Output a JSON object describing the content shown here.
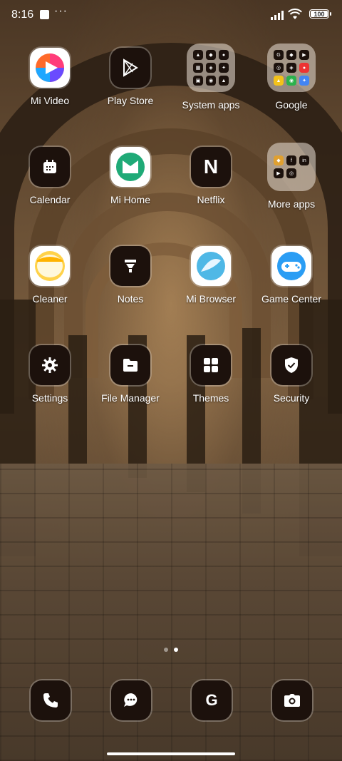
{
  "status_bar": {
    "time": "8:16",
    "battery": "100"
  },
  "apps": [
    {
      "key": "mi-video",
      "label": "Mi Video"
    },
    {
      "key": "play-store",
      "label": "Play Store"
    },
    {
      "key": "system-apps",
      "label": "System apps"
    },
    {
      "key": "google",
      "label": "Google"
    },
    {
      "key": "calendar",
      "label": "Calendar"
    },
    {
      "key": "mi-home",
      "label": "Mi Home"
    },
    {
      "key": "netflix",
      "label": "Netflix",
      "glyph": "N"
    },
    {
      "key": "more-apps",
      "label": "More apps"
    },
    {
      "key": "cleaner",
      "label": "Cleaner"
    },
    {
      "key": "notes",
      "label": "Notes"
    },
    {
      "key": "mi-browser",
      "label": "Mi Browser"
    },
    {
      "key": "game-center",
      "label": "Game Center"
    },
    {
      "key": "settings",
      "label": "Settings"
    },
    {
      "key": "file-manager",
      "label": "File Manager"
    },
    {
      "key": "themes",
      "label": "Themes"
    },
    {
      "key": "security",
      "label": "Security"
    }
  ],
  "dock": {
    "google_glyph": "G"
  },
  "pager": {
    "pages": 2,
    "current": 2
  },
  "colors": {
    "icon_bg": "#1c110c",
    "accent_green": "#1faa77",
    "browser_blue": "#4fb8e6",
    "game_blue": "#2a9df4"
  }
}
